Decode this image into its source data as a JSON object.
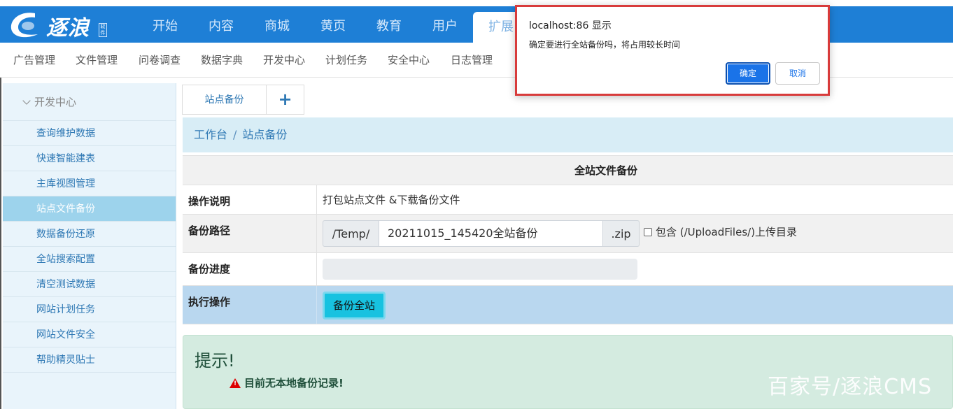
{
  "header": {
    "logo_text": "逐浪",
    "logo_mini": "软件",
    "nav": [
      "开始",
      "内容",
      "商城",
      "黄页",
      "教育",
      "用户",
      "扩展"
    ],
    "active_nav": "扩展"
  },
  "subnav": [
    "广告管理",
    "文件管理",
    "问卷调查",
    "数据字典",
    "开发中心",
    "计划任务",
    "安全中心",
    "日志管理"
  ],
  "sidebar": {
    "section": "开发中心",
    "items": [
      "查询维护数据",
      "快速智能建表",
      "主库视图管理",
      "站点文件备份",
      "数据备份还原",
      "全站搜索配置",
      "清空测试数据",
      "网站计划任务",
      "网站文件安全",
      "帮助精灵贴士"
    ],
    "active": "站点文件备份"
  },
  "tabs": {
    "items": [
      "站点备份"
    ],
    "add_label": "+"
  },
  "breadcrumb": {
    "root": "工作台",
    "sep": "/",
    "current": "站点备份"
  },
  "form": {
    "title": "全站文件备份",
    "desc_label": "操作说明",
    "desc_value": "打包站点文件 &下载备份文件",
    "path_label": "备份路径",
    "path_prefix": "/Temp/",
    "path_value": "20211015_145420全站备份",
    "path_suffix": ".zip",
    "include_label": "包含 (/UploadFiles/)上传目录",
    "include_checked": false,
    "progress_label": "备份进度",
    "progress_value": 0,
    "exec_label": "执行操作",
    "exec_button": "备份全站"
  },
  "tip": {
    "heading": "提示!",
    "message": "目前无本地备份记录!"
  },
  "watermark": "百家号/逐浪CMS",
  "dialog": {
    "title": "localhost:86 显示",
    "message": "确定要进行全站备份吗，将占用较长时间",
    "ok": "确定",
    "cancel": "取消"
  },
  "colors": {
    "header_bg": "#1e7fd6",
    "accent": "#17a2b8",
    "dialog_border": "#d83b3b"
  }
}
